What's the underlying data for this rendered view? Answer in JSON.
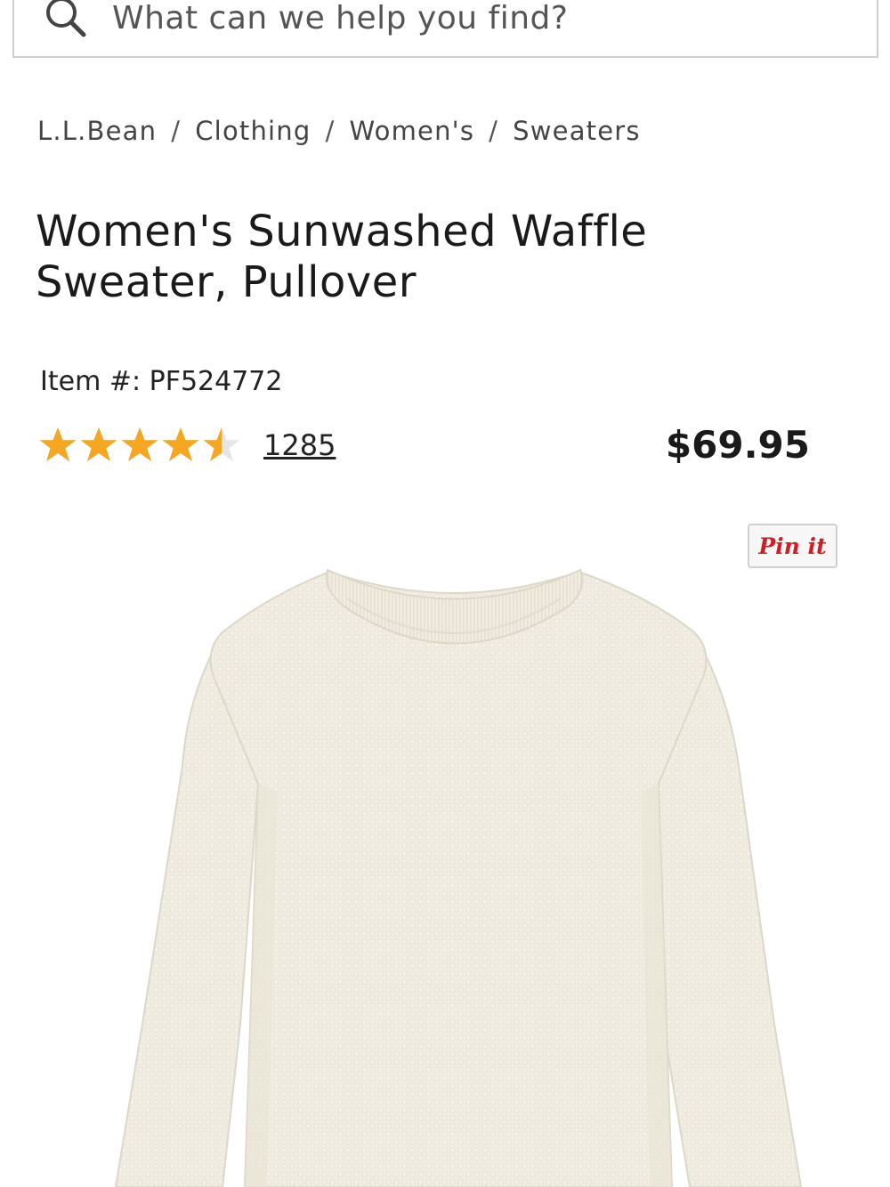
{
  "search": {
    "placeholder": "What can we help you find?",
    "icon": "search-icon"
  },
  "breadcrumb": {
    "items": [
      "L.L.Bean",
      "Clothing",
      "Women's",
      "Sweaters"
    ],
    "separator": "/"
  },
  "product": {
    "title": "Women's Sunwashed Waffle Sweater, Pullover",
    "item_number": "Item #: PF524772",
    "rating": 4.5,
    "rating_max": 5,
    "review_count": "1285",
    "price": "$69.95",
    "pin_label": "Pin it",
    "image_icon": "sweater-image"
  },
  "colors": {
    "star": "#f5a623",
    "star_empty": "#e6e6e6",
    "pinterest": "#cb2027",
    "sweater": "#f1ede2"
  }
}
